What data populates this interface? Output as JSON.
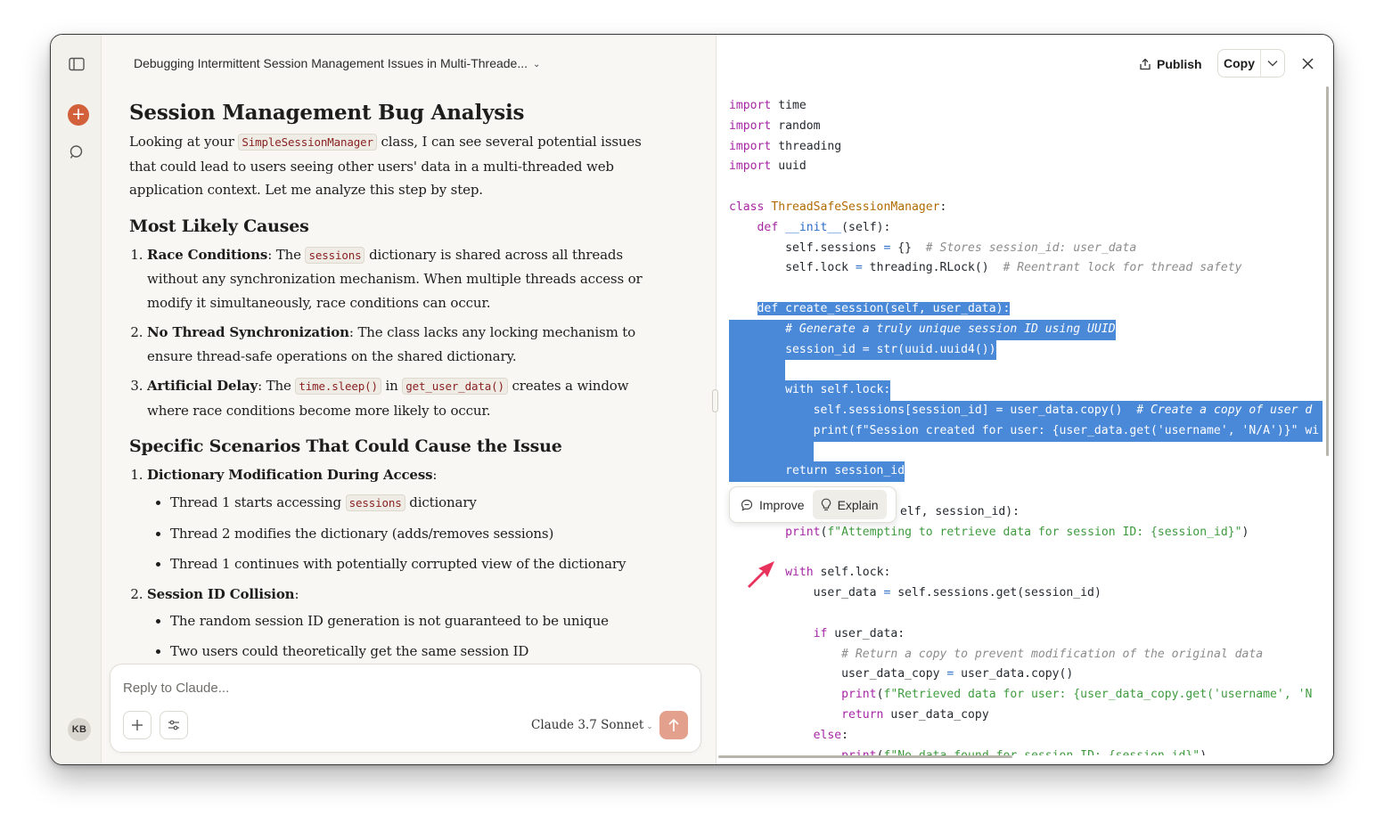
{
  "conversation": {
    "title": "Debugging Intermittent Session Management Issues in Multi-Threade..."
  },
  "user": {
    "initials": "KB"
  },
  "message": {
    "heading": "Session Management Bug Analysis",
    "intro_1": "Looking at your ",
    "intro_code": "SimpleSessionManager",
    "intro_2": " class, I can see several potential issues that could lead to users seeing other users' data in a multi-threaded web application context. Let me analyze this step by step.",
    "section1_title": "Most Likely Causes",
    "cause1_title": "Race Conditions",
    "cause1_a": ": The ",
    "cause1_code": "sessions",
    "cause1_b": " dictionary is shared across all threads without any synchronization mechanism. When multiple threads access or modify it simultaneously, race conditions can occur.",
    "cause2_title": "No Thread Synchronization",
    "cause2_text": ": The class lacks any locking mechanism to ensure thread-safe operations on the shared dictionary.",
    "cause3_title": "Artificial Delay",
    "cause3_a": ": The ",
    "cause3_code1": "time.sleep()",
    "cause3_b": " in ",
    "cause3_code2": "get_user_data()",
    "cause3_c": " creates a window where race conditions become more likely to occur.",
    "section2_title": "Specific Scenarios That Could Cause the Issue",
    "scenario1_title": "Dictionary Modification During Access",
    "scenario1_colon": ":",
    "scenario1_b1_a": "Thread 1 starts accessing ",
    "scenario1_b1_code": "sessions",
    "scenario1_b1_b": " dictionary",
    "scenario1_b2": "Thread 2 modifies the dictionary (adds/removes sessions)",
    "scenario1_b3": "Thread 1 continues with potentially corrupted view of the dictionary",
    "scenario2_title": "Session ID Collision",
    "scenario2_colon": ":",
    "scenario2_b1": "The random session ID generation is not guaranteed to be unique",
    "scenario2_b2": "Two users could theoretically get the same session ID"
  },
  "composer": {
    "placeholder": "Reply to Claude...",
    "model": "Claude 3.7 Sonnet"
  },
  "artifact": {
    "publish_label": "Publish",
    "copy_label": "Copy",
    "popover": {
      "improve_label": "Improve",
      "explain_label": "Explain"
    },
    "code_lines": [
      "import time",
      "import random",
      "import threading",
      "import uuid",
      "",
      "class ThreadSafeSessionManager:",
      "    def __init__(self):",
      "        self.sessions = {}  # Stores session_id: user_data",
      "        self.lock = threading.RLock()  # Reentrant lock for thread safety",
      "",
      "    def create_session(self, user_data):",
      "        # Generate a truly unique session ID using UUID",
      "        session_id = str(uuid.uuid4())",
      "",
      "        with self.lock:",
      "            self.sessions[session_id] = user_data.copy()  # Create a copy of user d",
      "            print(f\"Session created for user: {user_data.get('username', 'N/A')}\" wi",
      "",
      "        return session_id",
      "",
      "    def get_user_data(self, session_id):",
      "        print(f\"Attempting to retrieve data for session ID: {session_id}\")",
      "",
      "        with self.lock:",
      "            user_data = self.sessions.get(session_id)",
      "",
      "            if user_data:",
      "                # Return a copy to prevent modification of the original data",
      "                user_data_copy = user_data.copy()",
      "                print(f\"Retrieved data for user: {user_data_copy.get('username', 'N",
      "                return user_data_copy",
      "            else:",
      "                print(f\"No data found for session ID: {session_id}\")"
    ],
    "popover_line_tail": "elf, session_id):"
  },
  "colors": {
    "accent": "#d2603a",
    "selection": "#4a88d8",
    "keyword": "#a626a4",
    "string": "#3f9b3f",
    "comment": "#8c8c8c",
    "class_name": "#b06a00",
    "function_name": "#2f6fca",
    "arrow": "#e8335c"
  },
  "icons": {
    "sidebar_toggle": "sidebar-toggle-icon",
    "new_chat": "plus-circle-icon",
    "search": "search-chat-icon",
    "attach": "plus-icon",
    "tools": "sliders-icon",
    "send": "arrow-up-icon",
    "publish": "share-icon",
    "close": "close-icon",
    "improve": "speech-bubble-icon",
    "explain": "lightbulb-icon",
    "annotation": "arrow-icon"
  }
}
